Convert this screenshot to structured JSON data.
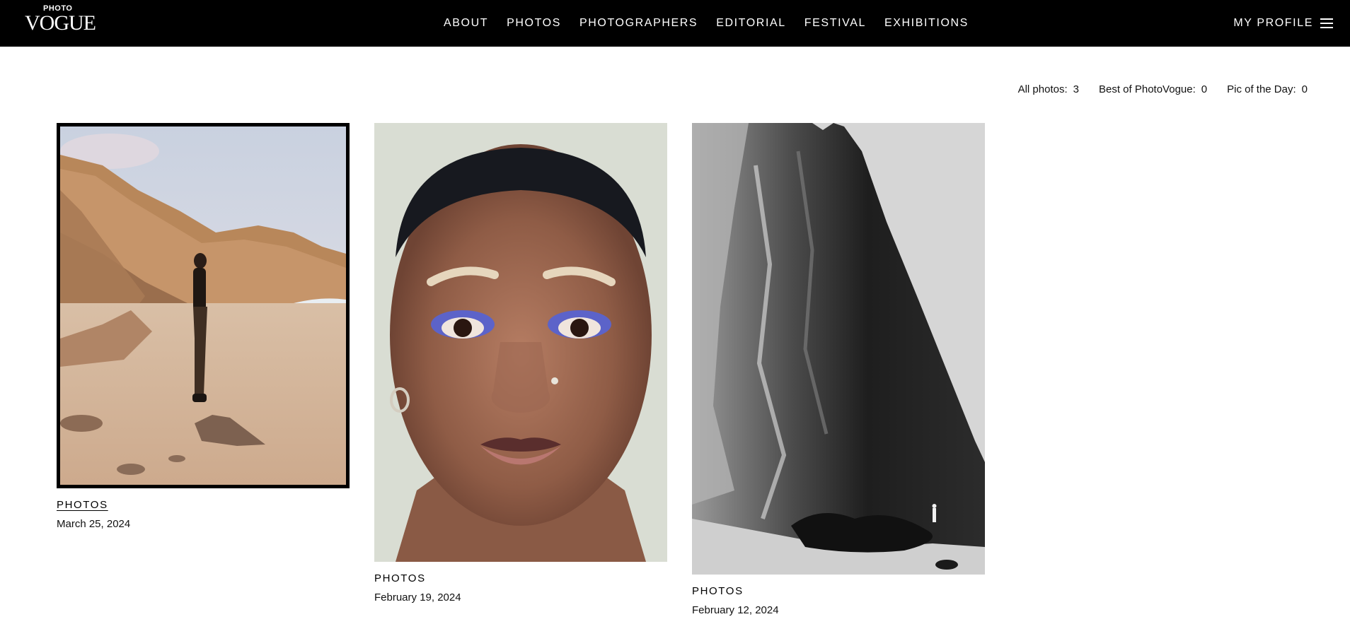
{
  "brand": {
    "small": "PHOTO",
    "big": "VOGUE"
  },
  "nav": {
    "items": [
      {
        "label": "ABOUT"
      },
      {
        "label": "PHOTOS"
      },
      {
        "label": "PHOTOGRAPHERS"
      },
      {
        "label": "EDITORIAL"
      },
      {
        "label": "FESTIVAL"
      },
      {
        "label": "EXHIBITIONS"
      }
    ],
    "profile_label": "MY PROFILE",
    "menu_icon": "hamburger-icon"
  },
  "counters": [
    {
      "label": "All photos:",
      "value": "3"
    },
    {
      "label": "Best of PhotoVogue:",
      "value": "0"
    },
    {
      "label": "Pic of the Day:",
      "value": "0"
    }
  ],
  "photos": [
    {
      "category": "PHOTOS",
      "date": "March 25, 2024",
      "subject": "woman standing on a rock on a sandy beach below cliffs"
    },
    {
      "category": "PHOTOS",
      "date": "February 19, 2024",
      "subject": "close-up portrait of a woman with blue eyeliner"
    },
    {
      "category": "PHOTOS",
      "date": "February 12, 2024",
      "subject": "black and white rock cliff with small figure"
    }
  ],
  "colors": {
    "header_bg": "#000000",
    "header_text": "#ffffff",
    "page_bg": "#ffffff"
  }
}
